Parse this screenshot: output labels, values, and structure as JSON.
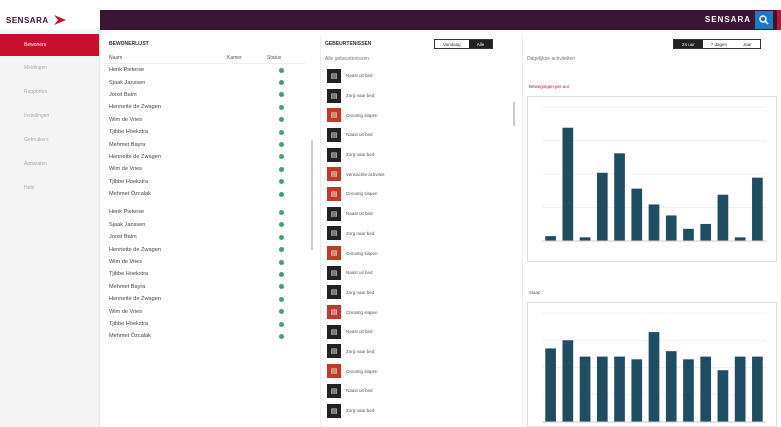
{
  "brand": {
    "name": "SENSARA"
  },
  "topbar": {
    "title": "SENSARA",
    "search_icon": "search-icon",
    "accent": "#c8102e",
    "bar_color": "#3d1535"
  },
  "sidebar": {
    "items": [
      {
        "label": "Bewoners",
        "active": true
      },
      {
        "label": "Meldingen"
      },
      {
        "label": "Rapporten"
      },
      {
        "label": "Instellingen"
      },
      {
        "label": "Gebruikers"
      },
      {
        "label": "Apparaten"
      },
      {
        "label": "Help"
      }
    ]
  },
  "residents": {
    "title": "BEWONERLIJST",
    "columns": [
      "Naam",
      "Kamer",
      "Status"
    ],
    "rows": [
      "Henk Pieterse",
      "Sjaak Janssen",
      "Joost Balm",
      "Henriette de Zwagen",
      "Wim de Vries",
      "Tjibbe Hoekstra",
      "Mehmet Bayra",
      "Henriette de Zwagen",
      "Wim de Vries",
      "Tjibbe Hoekstra",
      "Mehmet Özcalak",
      "Henk Pieterse",
      "Sjaak Janssen",
      "Joost Balm",
      "Henriette de Zwagen",
      "Wim de Vries",
      "Tjibbe Hoekstra",
      "Mehmet Bayra",
      "Henriette de Zwagen",
      "Wim de Vries",
      "Tjibbe Hoekstra",
      "Mehmet Özcalak"
    ]
  },
  "events": {
    "title": "GEBEURTENISSEN",
    "toggle": [
      "Vandaag",
      "Alle"
    ],
    "subtitle": "Alle gebeurtenissen",
    "rows": [
      {
        "t": "Naast uit bed",
        "c": "#222"
      },
      {
        "t": "Zorg naar bed",
        "c": "#222"
      },
      {
        "t": "Onrustig slapen",
        "c": "#c0392b"
      },
      {
        "t": "Naast uit bed",
        "c": "#222"
      },
      {
        "t": "Zorg naar bed",
        "c": "#222"
      },
      {
        "t": "Verwachte activiteit",
        "c": "#c0392b"
      },
      {
        "t": "Onrustig slapen",
        "c": "#c0392b"
      },
      {
        "t": "Naast uit bed",
        "c": "#222"
      },
      {
        "t": "Zorg naar bed",
        "c": "#222"
      },
      {
        "t": "Onrustig slapen",
        "c": "#c0392b"
      },
      {
        "t": "Naast uit bed",
        "c": "#222"
      },
      {
        "t": "Zorg naar bed",
        "c": "#222"
      },
      {
        "t": "Onrustig slapen",
        "c": "#c0392b"
      },
      {
        "t": "Naast uit bed",
        "c": "#222"
      },
      {
        "t": "Zorg naar bed",
        "c": "#222"
      },
      {
        "t": "Onrustig slapen",
        "c": "#c0392b"
      },
      {
        "t": "Naast uit bed",
        "c": "#222"
      },
      {
        "t": "Zorg naar bed",
        "c": "#222"
      }
    ]
  },
  "stats": {
    "toggle": [
      "24 uur",
      "7 dagen",
      "Jaar"
    ],
    "subtitle": "Dagelijkse activiteiten",
    "chart1_title": "Bewegingen per uur",
    "chart2_title": "Slaap",
    "color": "#1f4e63"
  },
  "chart_data": [
    {
      "type": "bar",
      "values": [
        0.4,
        9.3,
        0.3,
        5.6,
        7.2,
        4.3,
        3.0,
        2.1,
        1.0,
        1.4,
        3.8,
        0.3,
        5.2
      ],
      "ylim": [
        0,
        11
      ]
    },
    {
      "type": "bar",
      "values": [
        5.4,
        6.0,
        4.8,
        4.8,
        4.8,
        4.6,
        6.6,
        5.2,
        4.6,
        4.8,
        3.8,
        4.8,
        4.8
      ],
      "ylim": [
        0,
        8
      ]
    }
  ]
}
